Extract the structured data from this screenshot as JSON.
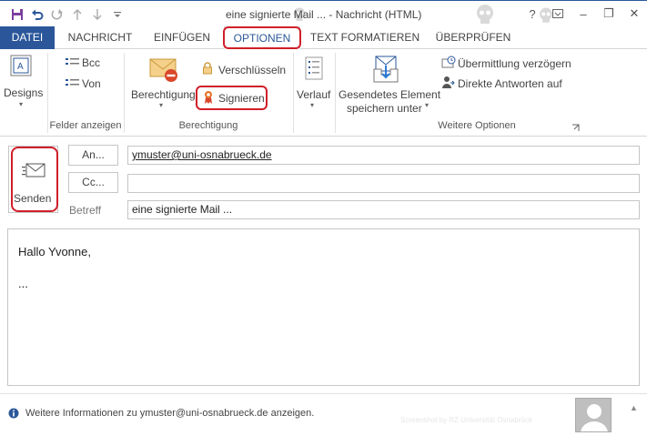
{
  "window": {
    "title": "eine signierte Mail ... - Nachricht (HTML)",
    "controls": {
      "help": "?",
      "minimize": "–",
      "restore": "❐",
      "close": "✕"
    }
  },
  "tabs": [
    {
      "label": "DATEI"
    },
    {
      "label": "NACHRICHT"
    },
    {
      "label": "EINFÜGEN"
    },
    {
      "label": "OPTIONEN",
      "active": true
    },
    {
      "label": "TEXT FORMATIEREN"
    },
    {
      "label": "ÜBERPRÜFEN"
    }
  ],
  "ribbon": {
    "designs": "Designs",
    "bcc": "Bcc",
    "von": "Von",
    "felder_anzeigen": "Felder anzeigen",
    "berechtigung_btn": "Berechtigung",
    "verschluesseln": "Verschlüsseln",
    "signieren": "Signieren",
    "berechtigung_group": "Berechtigung",
    "verlauf": "Verlauf",
    "gesendetes_line1": "Gesendetes Element",
    "gesendetes_line2": "speichern unter",
    "uebermittlung": "Übermittlung verzögern",
    "direkte_antworten": "Direkte Antworten auf",
    "weitere_optionen": "Weitere Optionen"
  },
  "compose": {
    "send_label": "Senden",
    "an_label": "An...",
    "cc_label": "Cc...",
    "betreff_label": "Betreff",
    "to_value": "ymuster@uni-osnabrueck.de",
    "cc_value": "",
    "subject_value": "eine signierte Mail ..."
  },
  "body": {
    "line1": "Hallo Yvonne,",
    "line2": "..."
  },
  "footer": {
    "info": "Weitere Informationen zu ymuster@uni-osnabrueck.de anzeigen.",
    "watermark": "Screenshot by RZ Universität Osnabrück"
  },
  "colors": {
    "accent": "#2b579a",
    "highlight": "#d01f2a"
  }
}
